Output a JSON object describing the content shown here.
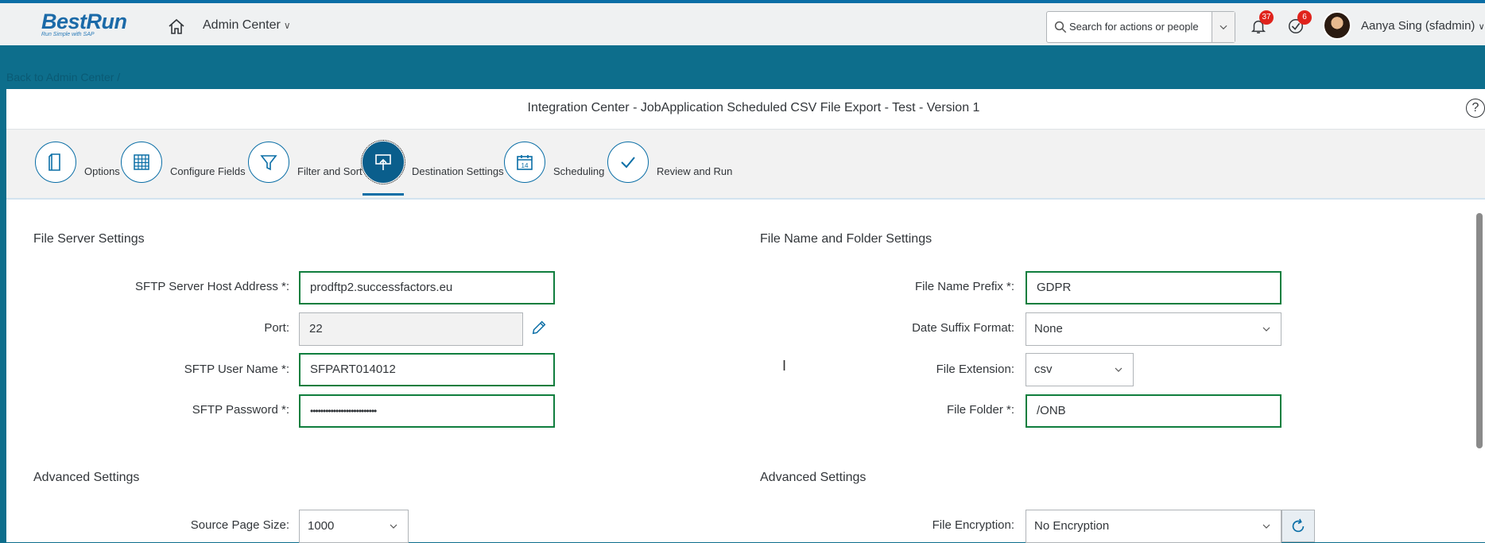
{
  "shell": {
    "logo": "BestRun",
    "logo_tagline": "Run Simple with SAP",
    "home_icon": "home-icon",
    "admin_center_label": "Admin Center",
    "search_placeholder": "Search for actions or people",
    "notifications_count": "37",
    "todo_count": "6",
    "user_name": "Aanya Sing (sfadmin)"
  },
  "back_link": "Back to Admin Center /",
  "page": {
    "title": "Integration Center - JobApplication Scheduled CSV File Export - Test - Version 1",
    "help": "?"
  },
  "steps": [
    {
      "label": "Options",
      "icon": "document-icon"
    },
    {
      "label": "Configure Fields",
      "icon": "grid-icon"
    },
    {
      "label": "Filter and Sort",
      "icon": "filter-icon"
    },
    {
      "label": "Destination Settings",
      "icon": "upload-icon",
      "active": true
    },
    {
      "label": "Scheduling",
      "icon": "calendar-icon",
      "calendar_day": "14"
    },
    {
      "label": "Review and Run",
      "icon": "check-icon"
    }
  ],
  "file_server": {
    "title": "File Server Settings",
    "host_label": "SFTP Server Host Address *:",
    "host_value": "prodftp2.successfactors.eu",
    "port_label": "Port:",
    "port_value": "22",
    "user_label": "SFTP User Name *:",
    "user_value": "SFPART014012",
    "password_label": "SFTP Password *:",
    "password_value": "••••••••••••••••••••••••••"
  },
  "file_name": {
    "title": "File Name and Folder Settings",
    "prefix_label": "File Name Prefix *:",
    "prefix_value": "GDPR",
    "date_label": "Date Suffix Format:",
    "date_value": "None",
    "ext_label": "File Extension:",
    "ext_value": "csv",
    "folder_label": "File Folder *:",
    "folder_value": "/ONB"
  },
  "advanced_left": {
    "title": "Advanced Settings",
    "page_size_label": "Source Page Size:",
    "page_size_value": "1000"
  },
  "advanced_right": {
    "title": "Advanced Settings",
    "encryption_label": "File Encryption:",
    "encryption_value": "No Encryption"
  },
  "colors": {
    "shell_bg": "#eff1f2",
    "accent": "#0a6ea6",
    "valid_border": "#107e3e",
    "badge": "#e0231c"
  }
}
